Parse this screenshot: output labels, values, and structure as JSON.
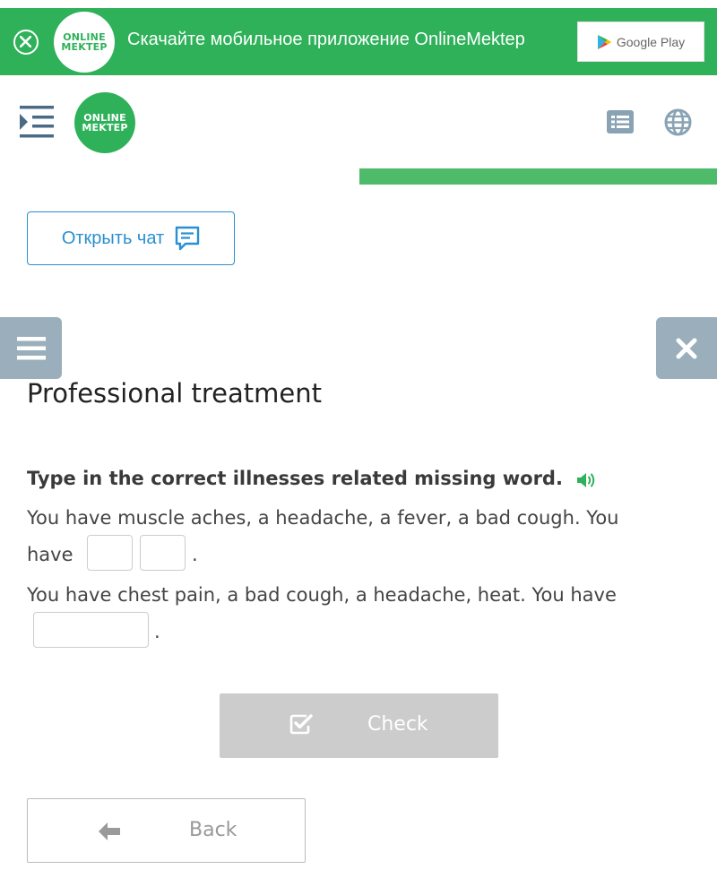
{
  "banner": {
    "logo_line1": "ONLINE",
    "logo_line2": "MEKTEP",
    "text": "Скачайте мобильное приложение OnlineMektep",
    "store_label": "Google Play"
  },
  "header": {
    "logo_line1": "ONLINE",
    "logo_line2": "MEKTEP"
  },
  "progress": {
    "value": 1.0
  },
  "chat": {
    "label": "Открыть чат"
  },
  "lesson": {
    "title": "Professional treatment",
    "instruction": "Type in the correct illnesses related missing word."
  },
  "questions": [
    {
      "line1": "You have muscle aches, a headache, a fever, a bad cough. You",
      "line2_prefix": "have",
      "line2_suffix": "."
    },
    {
      "line1": "You have chest pain, a bad cough, a headache, heat. You have",
      "line2_suffix": "."
    }
  ],
  "buttons": {
    "check": "Check",
    "back": "Back"
  },
  "colors": {
    "brand_green": "#2fb15a",
    "link_blue": "#2a8fd0",
    "side_tab": "#9aafbb",
    "disabled": "#cccccc"
  }
}
